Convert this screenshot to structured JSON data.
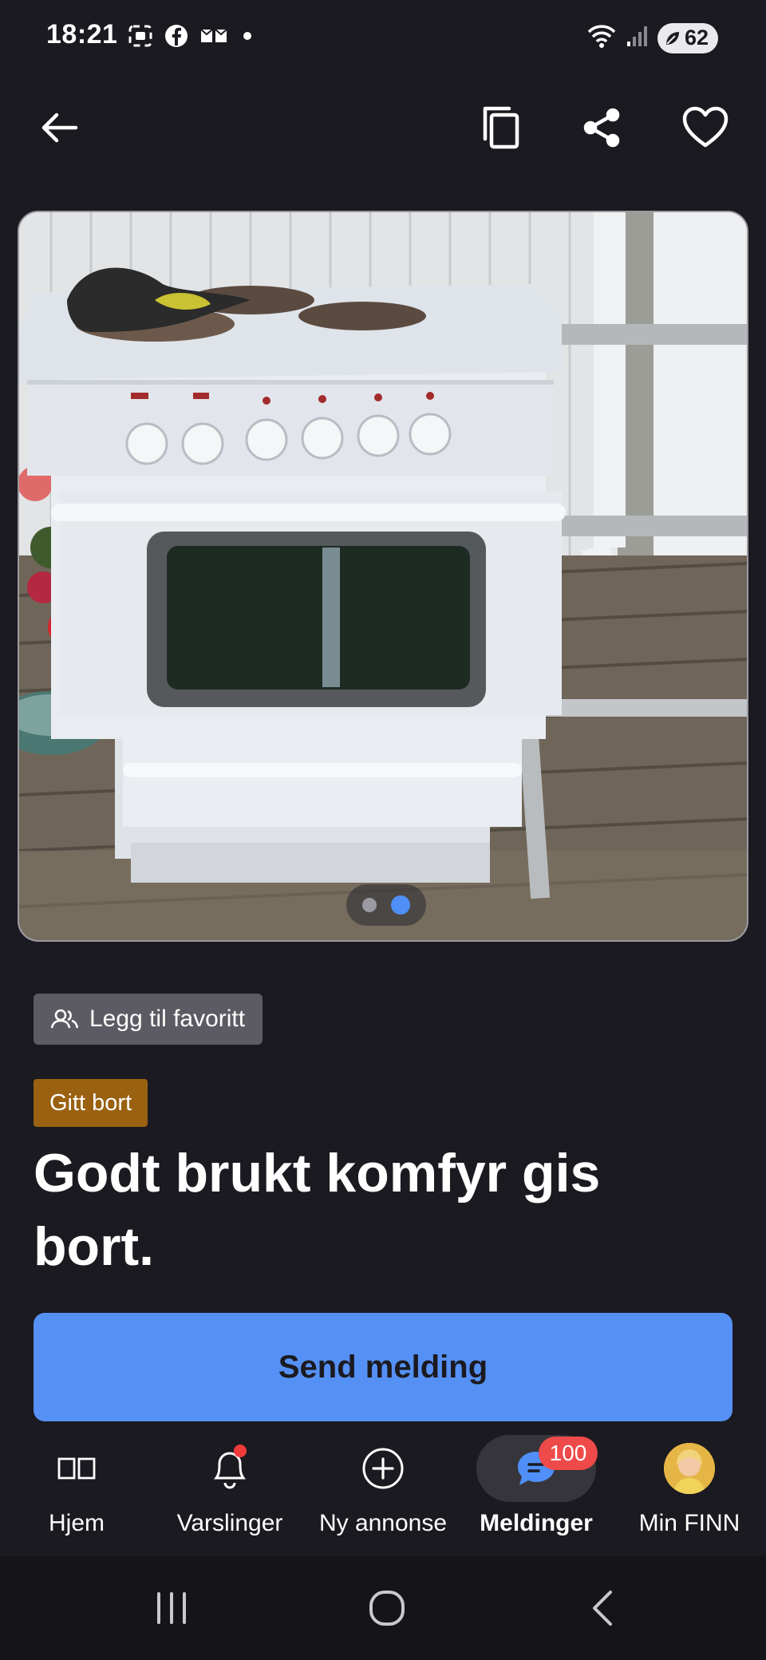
{
  "status_bar": {
    "time": "18:21",
    "battery": "62",
    "icons_left": [
      "screenshot-icon",
      "facebook-icon",
      "message-icon",
      "dot-icon"
    ],
    "icons_right": [
      "wifi-icon",
      "signal-icon",
      "battery-icon"
    ]
  },
  "top_bar": {
    "icons": [
      "back-arrow-icon",
      "copy-icon",
      "share-icon",
      "heart-icon"
    ]
  },
  "gallery": {
    "image_count": 2,
    "active_index": 2
  },
  "listing": {
    "favorite_label": "Legg til favoritt",
    "badge": "Gitt bort",
    "title": "Godt brukt komfyr gis bort.",
    "cta": "Send melding"
  },
  "bottom_nav": {
    "items": [
      {
        "label": "Hjem",
        "icon": "book-icon"
      },
      {
        "label": "Varslinger",
        "icon": "bell-icon"
      },
      {
        "label": "Ny annonse",
        "icon": "plus-circle-icon"
      },
      {
        "label": "Meldinger",
        "icon": "chat-icon",
        "badge": "100"
      },
      {
        "label": "Min FINN",
        "icon": "avatar"
      }
    ],
    "active": "Meldinger"
  },
  "colors": {
    "background": "#1b1a20",
    "primary": "#5591f5",
    "badge": "#9a6110",
    "notification": "#ee4a4a"
  }
}
